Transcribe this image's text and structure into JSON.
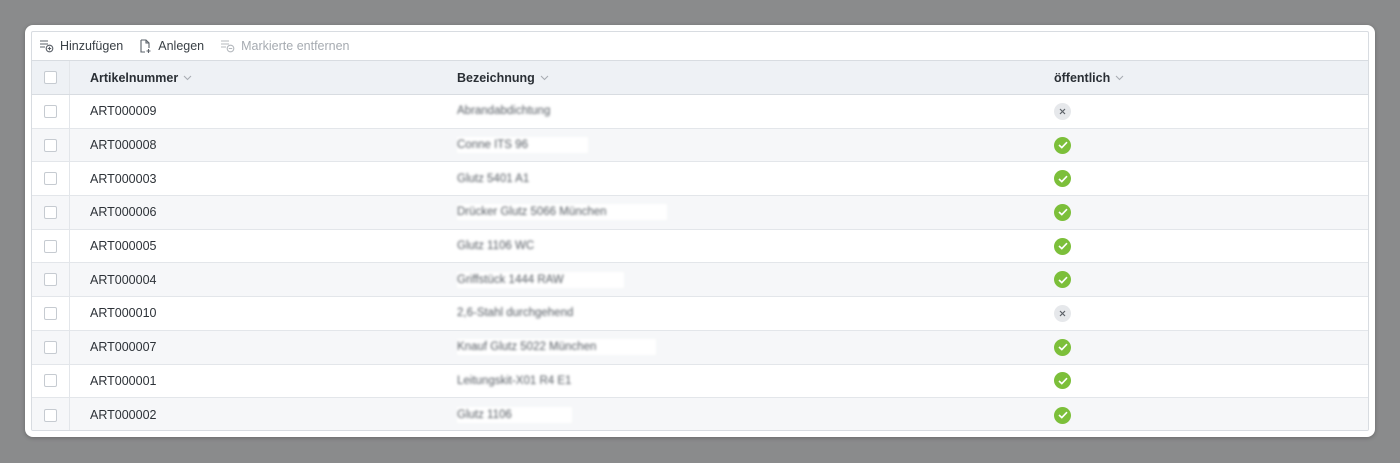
{
  "toolbar": {
    "add_label": "Hinzufügen",
    "create_label": "Anlegen",
    "remove_label": "Markierte entfernen"
  },
  "columns": {
    "art": "Artikelnummer",
    "bez": "Bezeichnung",
    "pub": "öffentlich"
  },
  "rows": [
    {
      "art": "ART000009",
      "bez": "Abrandabdichtung",
      "pub": false
    },
    {
      "art": "ART000008",
      "bez": "Conne ITS 96",
      "pub": true
    },
    {
      "art": "ART000003",
      "bez": "Glutz 5401 A1",
      "pub": true
    },
    {
      "art": "ART000006",
      "bez": "Drücker Glutz 5066 München",
      "pub": true
    },
    {
      "art": "ART000005",
      "bez": "Glutz 1106 WC",
      "pub": true
    },
    {
      "art": "ART000004",
      "bez": "Griffstück 1444 RAW",
      "pub": true
    },
    {
      "art": "ART000010",
      "bez": "2,6-Stahl durchgehend",
      "pub": false
    },
    {
      "art": "ART000007",
      "bez": "Knauf Glutz 5022 München",
      "pub": true
    },
    {
      "art": "ART000001",
      "bez": "Leitungskit-X01 R4 E1",
      "pub": true
    },
    {
      "art": "ART000002",
      "bez": "Glutz 1106",
      "pub": true
    }
  ],
  "colors": {
    "ok": "#7cbf3a",
    "no": "#e6e8eb"
  }
}
